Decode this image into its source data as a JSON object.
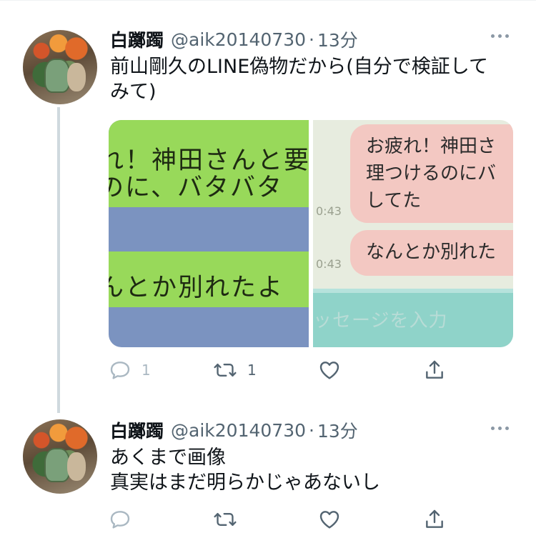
{
  "tweets": [
    {
      "user": {
        "name": "白躑躅",
        "handle": "@aik20140730"
      },
      "separator": "·",
      "time": "13分",
      "text_lines": [
        "前山剛久のLINE偽物だから(自分で検証して",
        "みて)"
      ],
      "media": {
        "left": {
          "line1": "れ！神田さんと要",
          "line2": "のに、バタバタ",
          "line3": "んとか別れたよ"
        },
        "right": {
          "bubble1_lines": [
            "お疲れ！神田さ",
            "理つけるのにバ",
            "してた"
          ],
          "bubble2_line": "なんとか別れた",
          "time1": "0:43",
          "time2": "0:43",
          "input_placeholder": "ッセージを入力"
        }
      },
      "actions": {
        "reply_count": "1",
        "retweet_count": "1",
        "like_count": ""
      }
    },
    {
      "user": {
        "name": "白躑躅",
        "handle": "@aik20140730"
      },
      "separator": "·",
      "time": "13分",
      "text_lines": [
        "あくまで画像",
        "真実はまだ明らかじゃあないし"
      ],
      "actions": {
        "reply_count": "",
        "retweet_count": "",
        "like_count": ""
      }
    }
  ],
  "icons": {
    "reply": "reply-icon",
    "retweet": "retweet-icon",
    "like": "heart-icon",
    "share": "share-icon",
    "more": "more-icon"
  },
  "colors": {
    "text": "#0f1419",
    "secondary": "#536471",
    "thread_line": "#cfd9de",
    "muted_icon": "#aab8c2"
  }
}
